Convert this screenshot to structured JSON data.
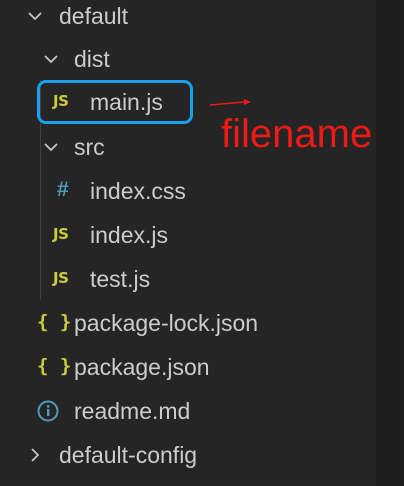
{
  "tree": {
    "default": {
      "label": "default",
      "expanded": true
    },
    "dist": {
      "label": "dist",
      "expanded": true
    },
    "main_js": {
      "label": "main.js",
      "icon": "JS"
    },
    "src": {
      "label": "src",
      "expanded": true
    },
    "index_css": {
      "label": "index.css",
      "icon": "#"
    },
    "index_js": {
      "label": "index.js",
      "icon": "JS"
    },
    "test_js": {
      "label": "test.js",
      "icon": "JS"
    },
    "package_lock": {
      "label": "package-lock.json",
      "icon": "{ }"
    },
    "package_json": {
      "label": "package.json",
      "icon": "{ }"
    },
    "readme": {
      "label": "readme.md",
      "icon": "info-icon"
    },
    "default_config": {
      "label": "default-config",
      "expanded": false
    }
  },
  "annotation": {
    "text": "filename",
    "color": "#ee1a16",
    "highlight_color": "#1aa1ee"
  },
  "colors": {
    "background": "#252526",
    "text": "#cccccc",
    "js_icon": "#cbcb41",
    "css_icon": "#519aba",
    "json_icon": "#cbcb41",
    "info_icon": "#519aba"
  }
}
